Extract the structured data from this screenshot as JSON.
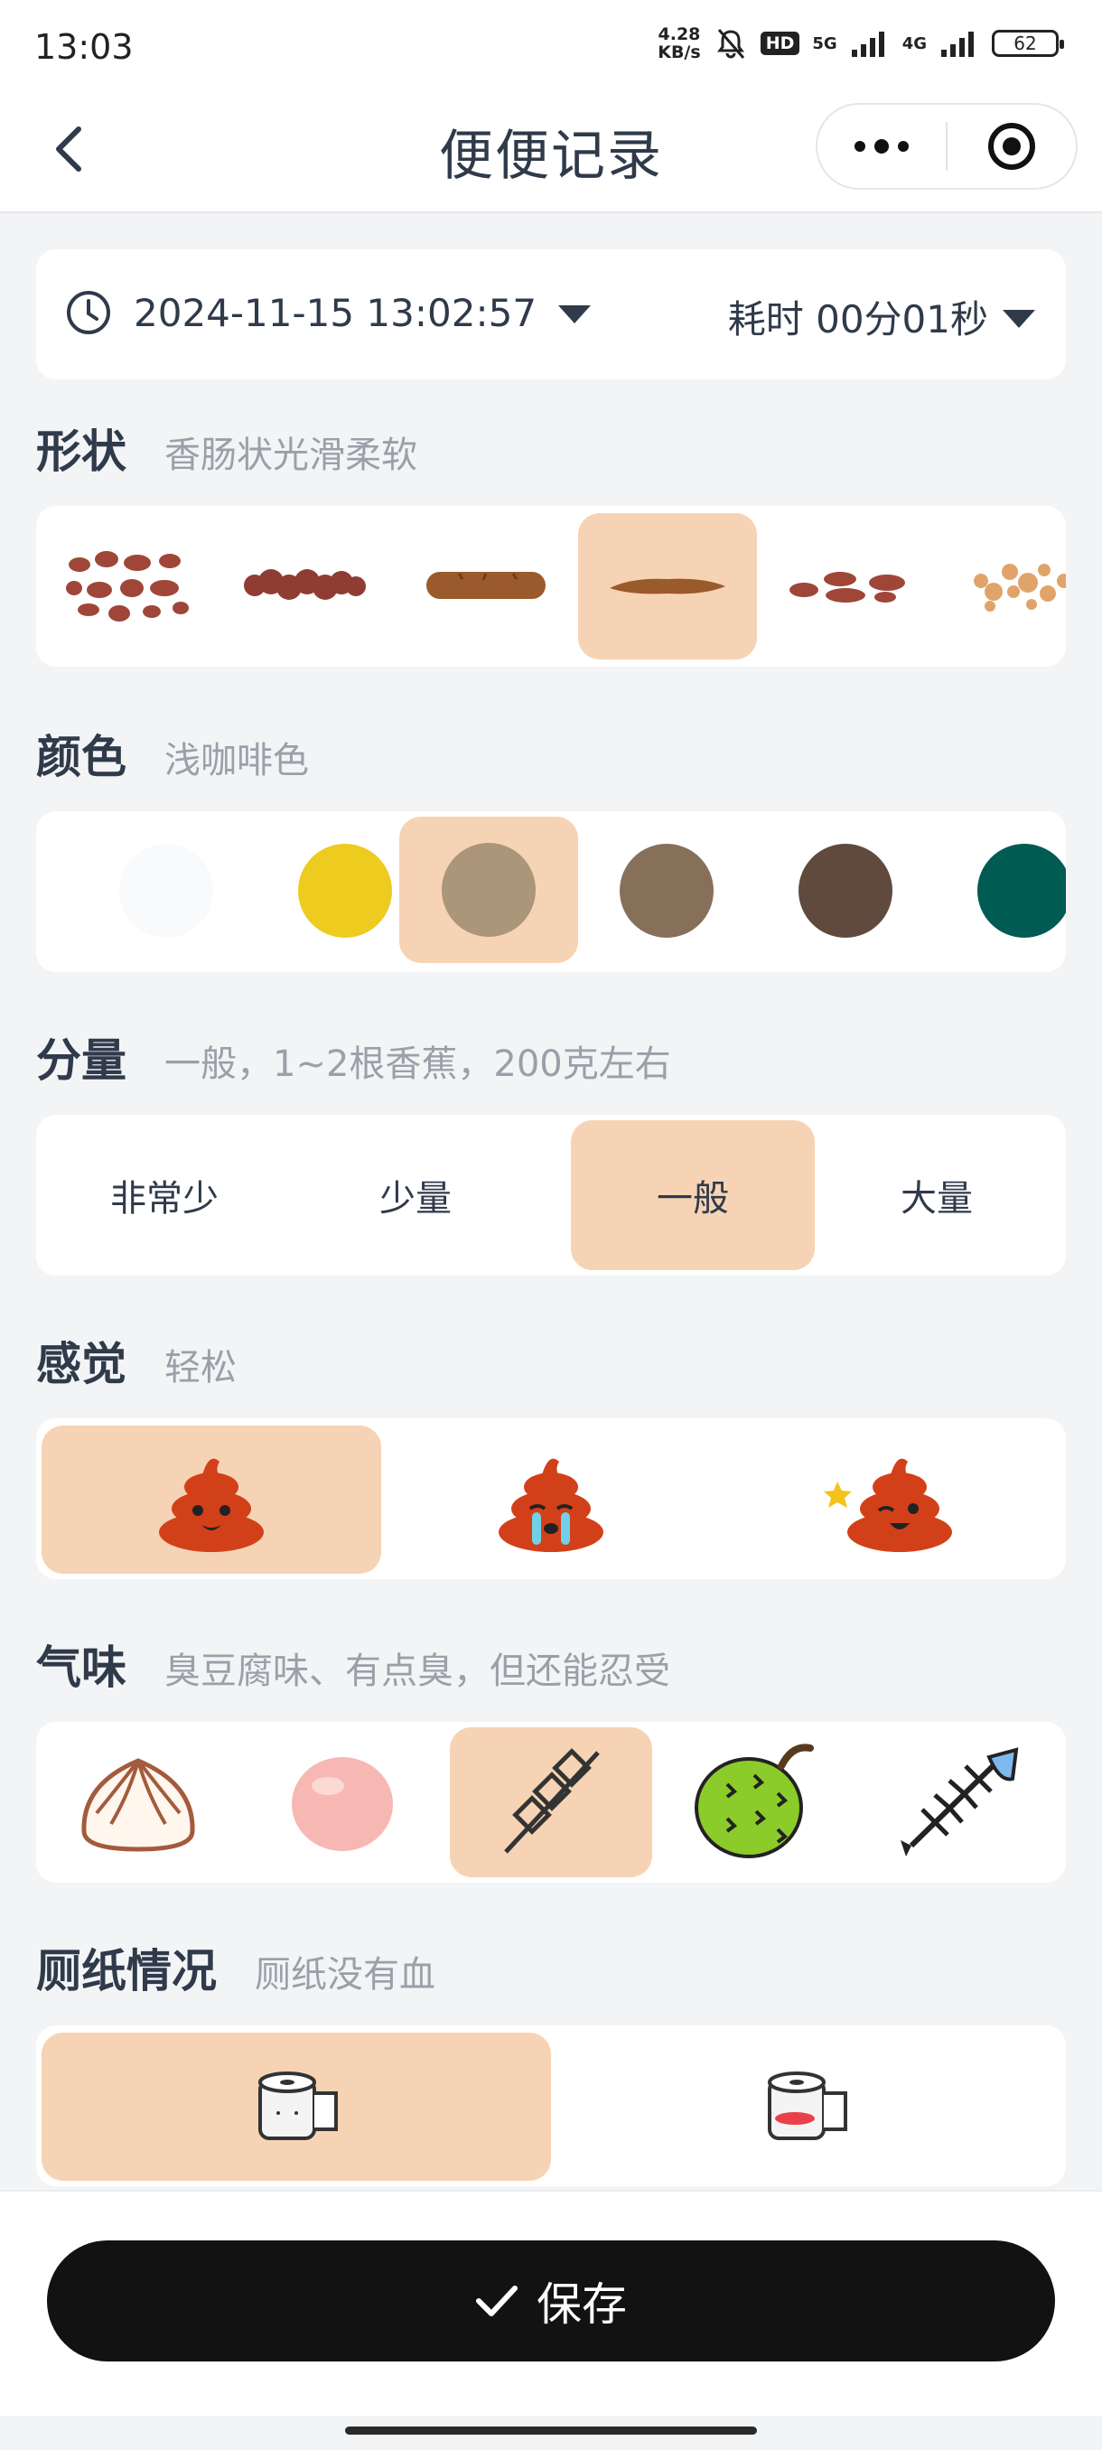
{
  "status_bar": {
    "time": "13:03",
    "net_speed_value": "4.28",
    "net_speed_unit": "KB/s",
    "hd_label": "HD",
    "signal_1": "5G",
    "signal_2": "4G",
    "battery": "62"
  },
  "nav": {
    "title": "便便记录",
    "back_icon": "chevron-left-icon",
    "more_icon": "more-dots-icon",
    "target_icon": "target-icon"
  },
  "datetime": {
    "value": "2024-11-15 13:02:57",
    "duration": "耗时 00分01秒"
  },
  "shape": {
    "title": "形状",
    "selected_desc": "香肠状光滑柔软",
    "selected_index": 3,
    "options": [
      "separate-lumps",
      "lumpy-sausage",
      "cracked-sausage",
      "smooth-sausage",
      "soft-blobs",
      "mushy-pieces"
    ]
  },
  "color": {
    "title": "颜色",
    "selected_desc": "浅咖啡色",
    "selected_index": 2,
    "swatches": [
      "#f9fafc",
      "#eecb1f",
      "#ab9679",
      "#86705a",
      "#5f4a3d",
      "#005b53"
    ]
  },
  "amount": {
    "title": "分量",
    "selected_desc": "一般，1~2根香蕉，200克左右",
    "selected_index": 2,
    "options": [
      "非常少",
      "少量",
      "一般",
      "大量"
    ]
  },
  "feeling": {
    "title": "感觉",
    "selected_desc": "轻松",
    "selected_index": 0,
    "options": [
      "happy-poop-icon",
      "crying-poop-icon",
      "winking-poop-icon"
    ]
  },
  "smell": {
    "title": "气味",
    "selected_desc": "臭豆腐味、有点臭，但还能忍受",
    "selected_index": 2,
    "options": [
      "bun-icon",
      "egg-icon",
      "skewer-icon",
      "durian-icon",
      "fishbone-icon"
    ]
  },
  "paper": {
    "title": "厕纸情况",
    "selected_desc": "厕纸没有血",
    "selected_index": 0,
    "options": [
      "clean-toilet-paper-icon",
      "bloody-toilet-paper-icon"
    ]
  },
  "save": {
    "label": "保存"
  }
}
